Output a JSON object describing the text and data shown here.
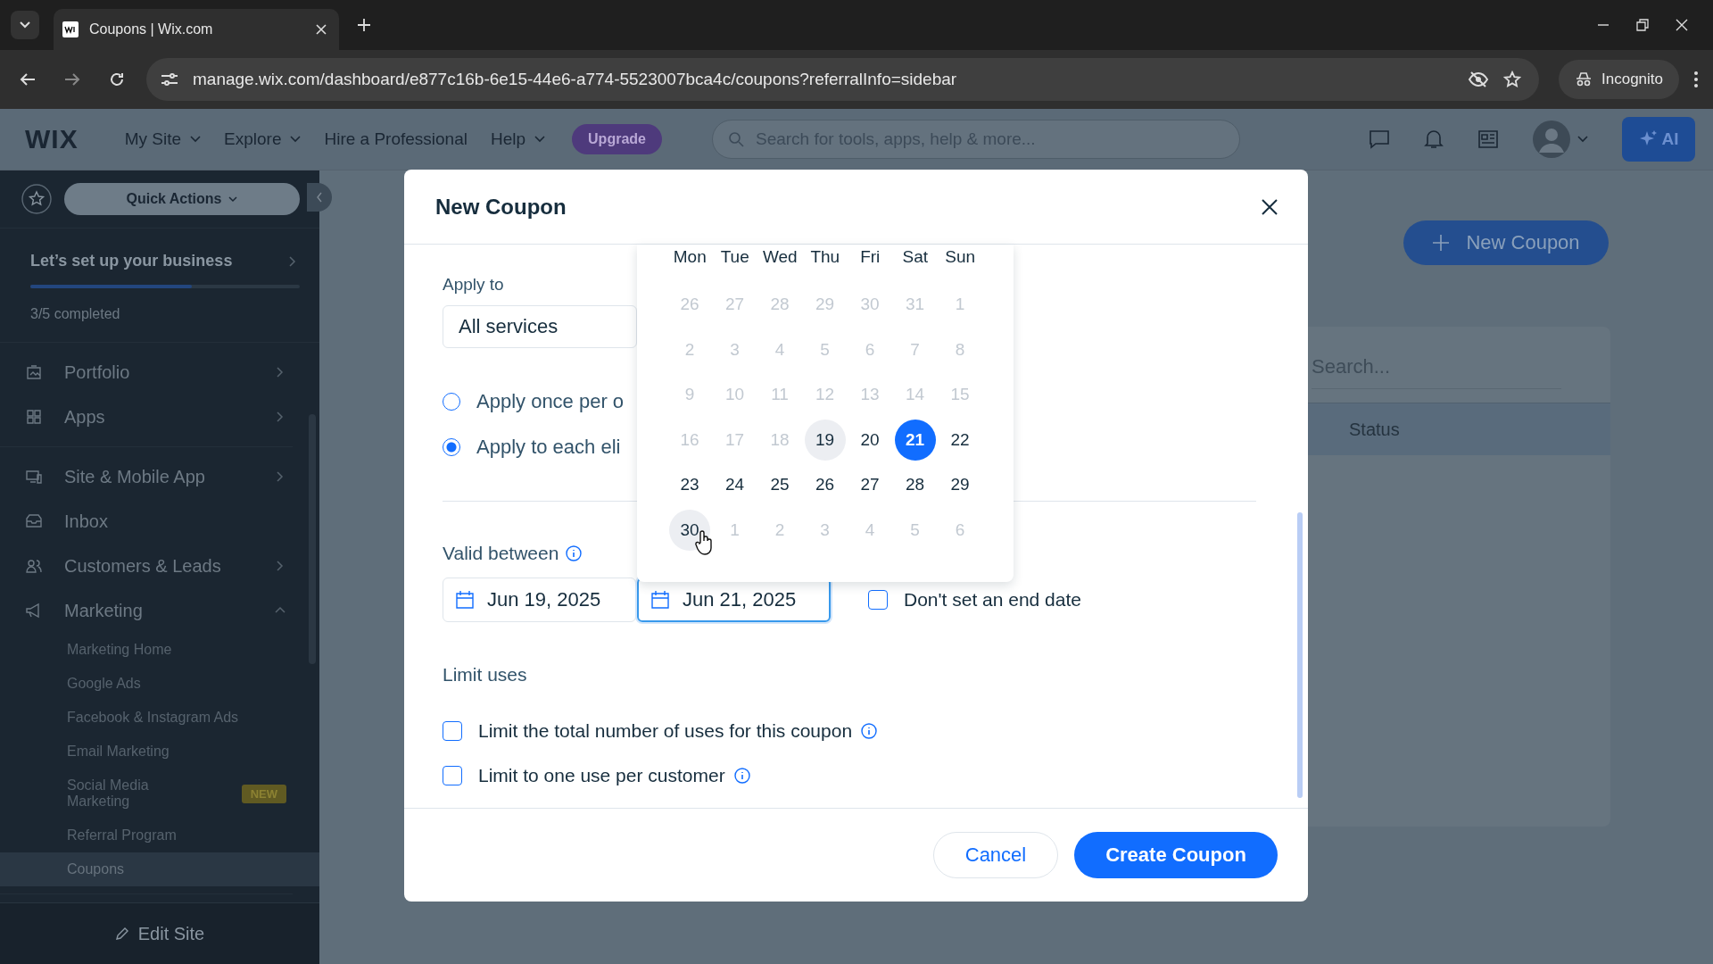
{
  "browser": {
    "tab_title": "Coupons | Wix.com",
    "url": "manage.wix.com/dashboard/e877c16b-6e15-44e6-a774-5523007bca4c/coupons?referralInfo=sidebar",
    "incognito": "Incognito"
  },
  "header": {
    "logo": "WIX",
    "nav": [
      {
        "label": "My Site",
        "dropdown": true
      },
      {
        "label": "Explore",
        "dropdown": true
      },
      {
        "label": "Hire a Professional",
        "dropdown": false
      },
      {
        "label": "Help",
        "dropdown": true
      }
    ],
    "upgrade": "Upgrade",
    "search_placeholder": "Search for tools, apps, help & more...",
    "ai": "AI"
  },
  "sidebar": {
    "quick_actions": "Quick Actions",
    "setup": {
      "title": "Let’s set up your business",
      "level": 0.6,
      "progress": "3/5 completed"
    },
    "groups": [
      [
        {
          "label": "Portfolio",
          "expandable": true,
          "expanded": false
        },
        {
          "label": "Apps",
          "expandable": true,
          "expanded": false
        }
      ],
      [
        {
          "label": "Site & Mobile App",
          "expandable": true,
          "expanded": false
        },
        {
          "label": "Inbox",
          "expandable": false,
          "expanded": false
        },
        {
          "label": "Customers & Leads",
          "expandable": true,
          "expanded": false
        },
        {
          "label": "Marketing",
          "expandable": true,
          "expanded": true,
          "children": [
            {
              "label": "Marketing Home",
              "selected": false
            },
            {
              "label": "Google Ads",
              "selected": false
            },
            {
              "label": "Facebook & Instagram Ads",
              "selected": false
            },
            {
              "label": "Email Marketing",
              "selected": false
            },
            {
              "label": "Social Media Marketing",
              "badge": "NEW",
              "selected": false
            },
            {
              "label": "Referral Program",
              "selected": false
            },
            {
              "label": "Coupons",
              "selected": true
            }
          ]
        }
      ]
    ],
    "edit_site": "Edit Site"
  },
  "background": {
    "new_coupon": "New Coupon",
    "search_placeholder": "Search...",
    "columns": [
      "Status"
    ]
  },
  "modal": {
    "title": "New Coupon",
    "apply_to_label": "Apply to",
    "apply_to_value": "All services",
    "radios": [
      {
        "label": "Apply once per o",
        "selected": false
      },
      {
        "label": "Apply to each eli",
        "selected": true
      }
    ],
    "valid_label": "Valid between",
    "start_date": "Jun 19, 2025",
    "end_date": "Jun 21, 2025",
    "end_focused": true,
    "no_end": {
      "label": "Don't set an end date",
      "checked": false
    },
    "limit_label": "Limit uses",
    "limits": [
      {
        "label": "Limit the total number of uses for this coupon",
        "checked": false
      },
      {
        "label": "Limit to one use per customer",
        "checked": false
      }
    ],
    "cancel": "Cancel",
    "create": "Create Coupon"
  },
  "calendar": {
    "weekdays": [
      "Mon",
      "Tue",
      "Wed",
      "Thu",
      "Fri",
      "Sat",
      "Sun"
    ],
    "weeks": [
      [
        {
          "label": "26",
          "selected": false,
          "disabled": true,
          "highlighted": false
        },
        {
          "label": "27",
          "selected": false,
          "disabled": true,
          "highlighted": false
        },
        {
          "label": "28",
          "selected": false,
          "disabled": true,
          "highlighted": false
        },
        {
          "label": "29",
          "selected": false,
          "disabled": true,
          "highlighted": false
        },
        {
          "label": "30",
          "selected": false,
          "disabled": true,
          "highlighted": false
        },
        {
          "label": "31",
          "selected": false,
          "disabled": true,
          "highlighted": false
        },
        {
          "label": "1",
          "selected": false,
          "disabled": true,
          "highlighted": false
        }
      ],
      [
        {
          "label": "2",
          "selected": false,
          "disabled": true,
          "highlighted": false
        },
        {
          "label": "3",
          "selected": false,
          "disabled": true,
          "highlighted": false
        },
        {
          "label": "4",
          "selected": false,
          "disabled": true,
          "highlighted": false
        },
        {
          "label": "5",
          "selected": false,
          "disabled": true,
          "highlighted": false
        },
        {
          "label": "6",
          "selected": false,
          "disabled": true,
          "highlighted": false
        },
        {
          "label": "7",
          "selected": false,
          "disabled": true,
          "highlighted": false
        },
        {
          "label": "8",
          "selected": false,
          "disabled": true,
          "highlighted": false
        }
      ],
      [
        {
          "label": "9",
          "selected": false,
          "disabled": true,
          "highlighted": false
        },
        {
          "label": "10",
          "selected": false,
          "disabled": true,
          "highlighted": false
        },
        {
          "label": "11",
          "selected": false,
          "disabled": true,
          "highlighted": false
        },
        {
          "label": "12",
          "selected": false,
          "disabled": true,
          "highlighted": false
        },
        {
          "label": "13",
          "selected": false,
          "disabled": true,
          "highlighted": false
        },
        {
          "label": "14",
          "selected": false,
          "disabled": true,
          "highlighted": false
        },
        {
          "label": "15",
          "selected": false,
          "disabled": true,
          "highlighted": false
        }
      ],
      [
        {
          "label": "16",
          "selected": false,
          "disabled": true,
          "highlighted": false
        },
        {
          "label": "17",
          "selected": false,
          "disabled": true,
          "highlighted": false
        },
        {
          "label": "18",
          "selected": false,
          "disabled": true,
          "highlighted": false
        },
        {
          "label": "19",
          "selected": false,
          "disabled": false,
          "highlighted": true
        },
        {
          "label": "20",
          "selected": false,
          "disabled": false,
          "highlighted": false
        },
        {
          "label": "21",
          "selected": true,
          "disabled": false,
          "highlighted": false
        },
        {
          "label": "22",
          "selected": false,
          "disabled": false,
          "highlighted": false
        }
      ],
      [
        {
          "label": "23",
          "selected": false,
          "disabled": false,
          "highlighted": false
        },
        {
          "label": "24",
          "selected": false,
          "disabled": false,
          "highlighted": false
        },
        {
          "label": "25",
          "selected": false,
          "disabled": false,
          "highlighted": false
        },
        {
          "label": "26",
          "selected": false,
          "disabled": false,
          "highlighted": false
        },
        {
          "label": "27",
          "selected": false,
          "disabled": false,
          "highlighted": false
        },
        {
          "label": "28",
          "selected": false,
          "disabled": false,
          "highlighted": false
        },
        {
          "label": "29",
          "selected": false,
          "disabled": false,
          "highlighted": false
        }
      ],
      [
        {
          "label": "30",
          "selected": false,
          "disabled": false,
          "highlighted": true
        },
        {
          "label": "1",
          "selected": false,
          "disabled": true,
          "highlighted": false
        },
        {
          "label": "2",
          "selected": false,
          "disabled": true,
          "highlighted": false
        },
        {
          "label": "3",
          "selected": false,
          "disabled": true,
          "highlighted": false
        },
        {
          "label": "4",
          "selected": false,
          "disabled": true,
          "highlighted": false
        },
        {
          "label": "5",
          "selected": false,
          "disabled": true,
          "highlighted": false
        },
        {
          "label": "6",
          "selected": false,
          "disabled": true,
          "highlighted": false
        }
      ]
    ]
  }
}
